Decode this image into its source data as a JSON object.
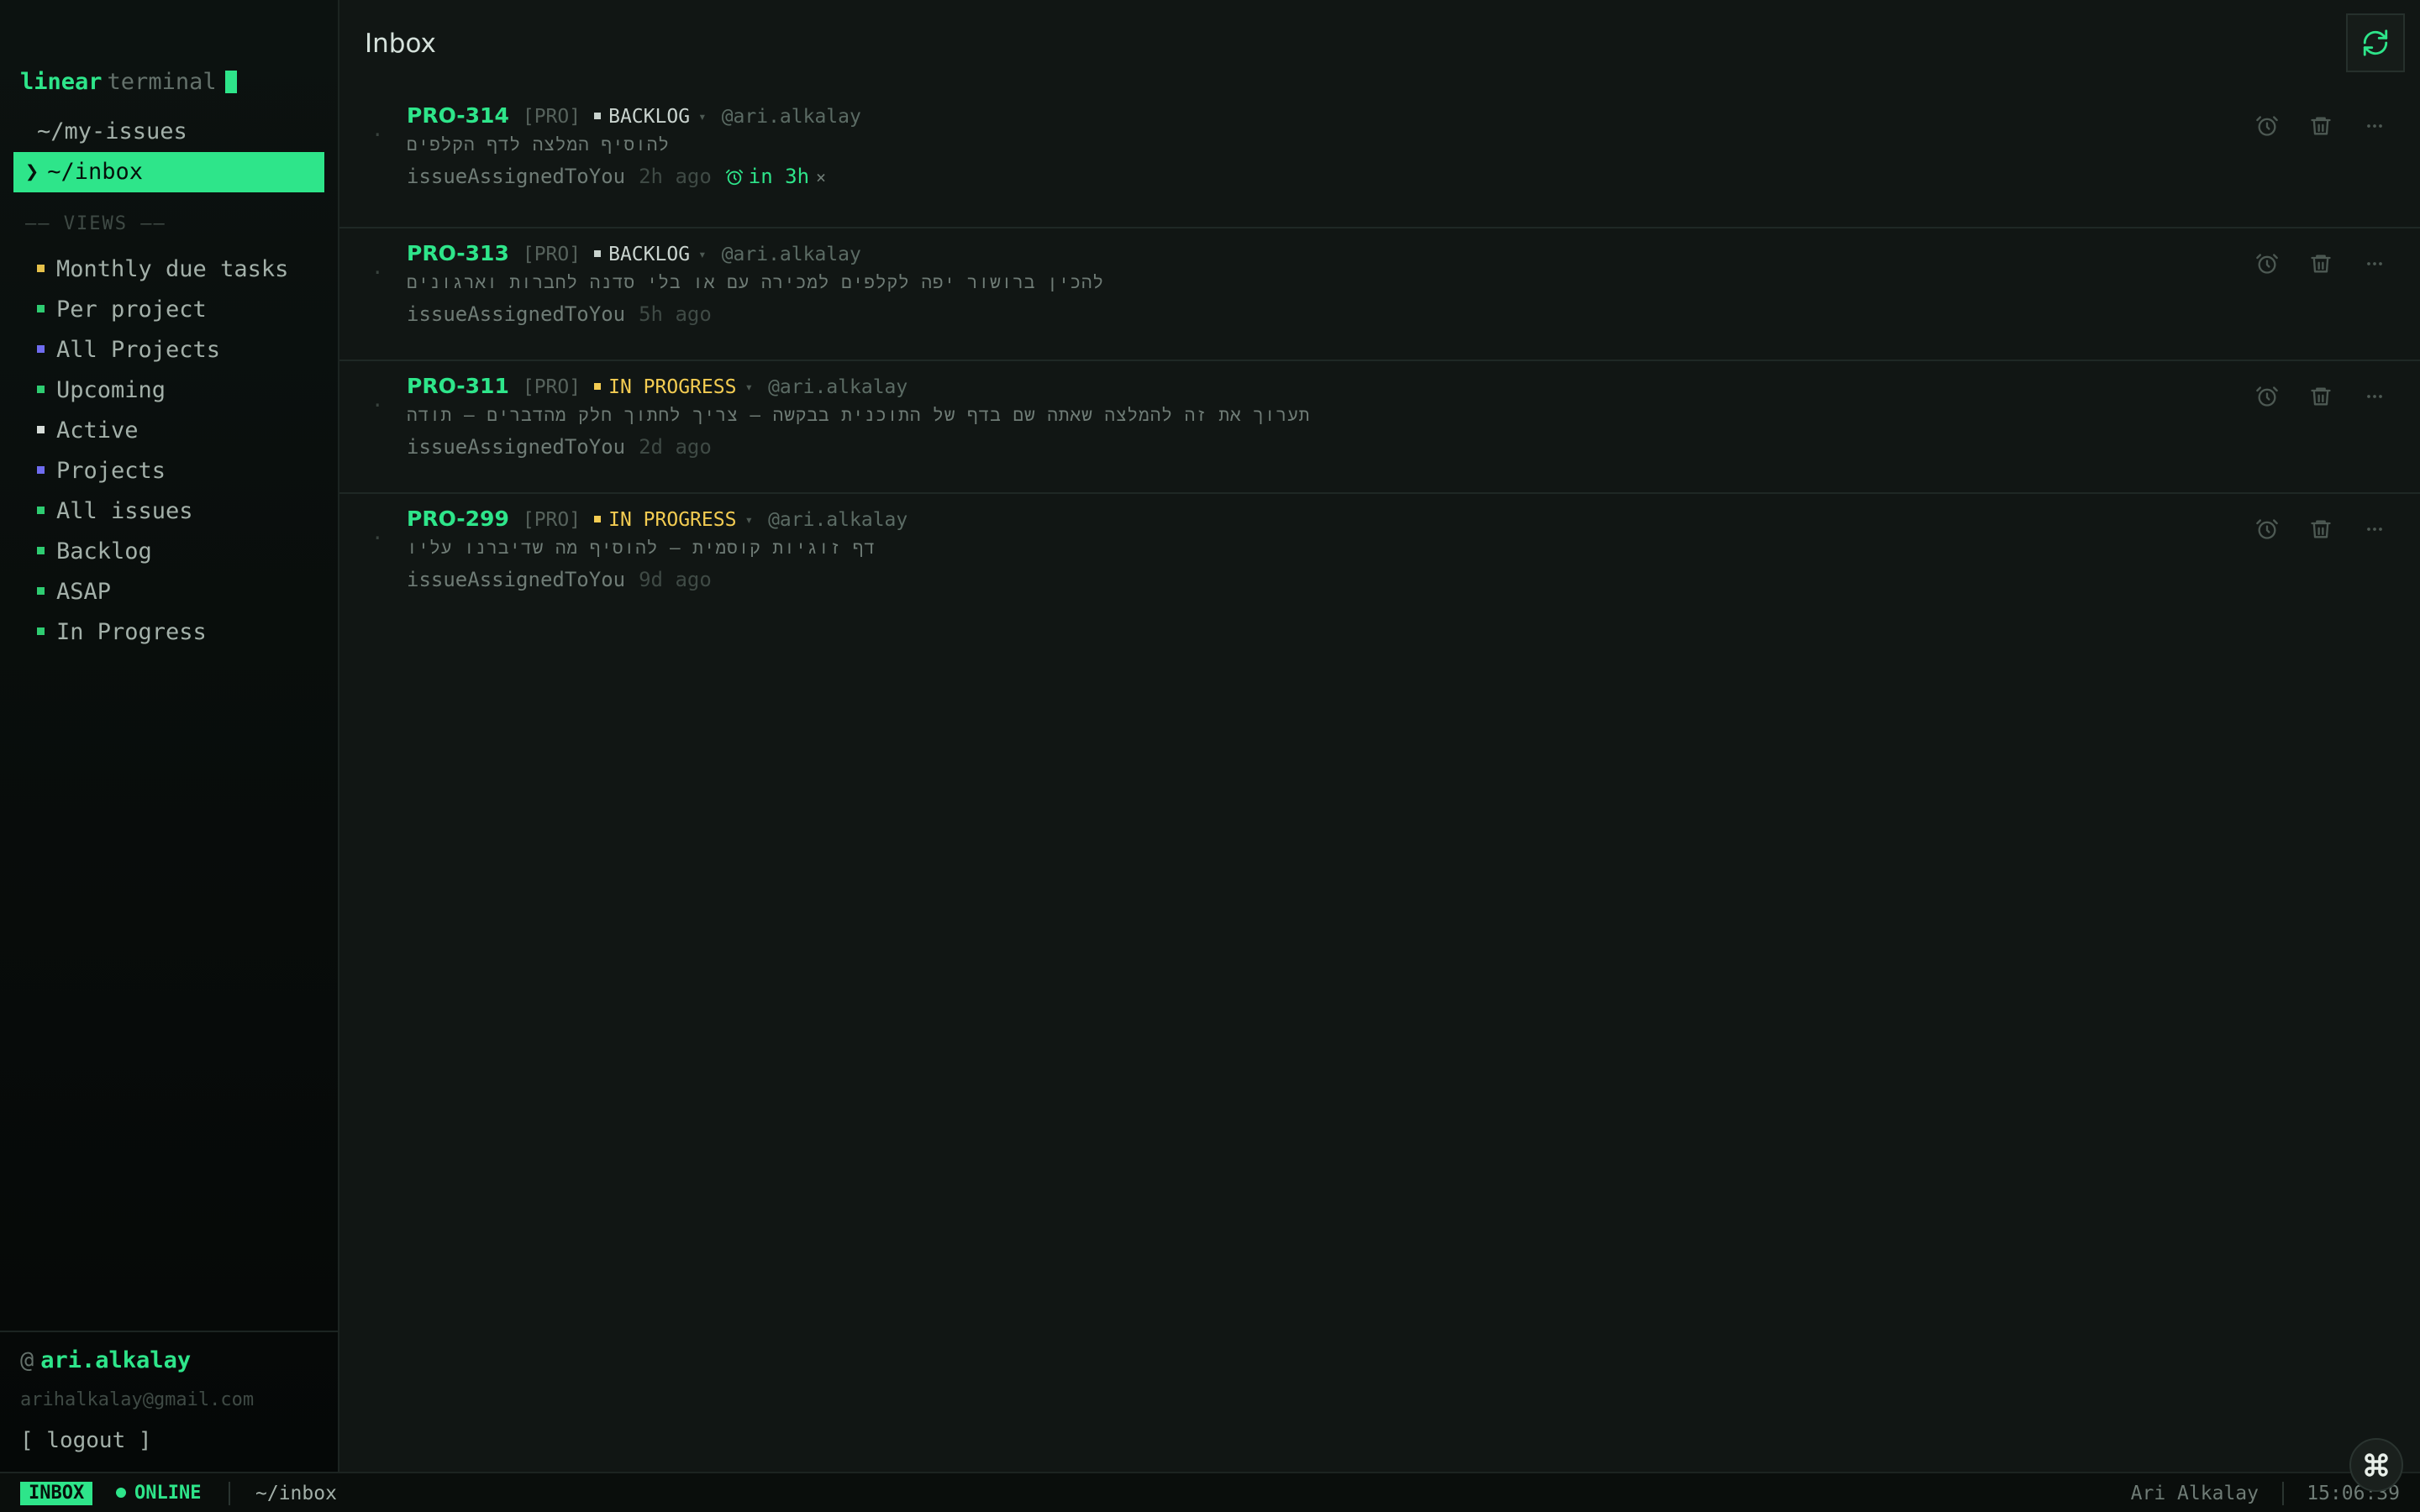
{
  "brand": {
    "name": "linear",
    "suffix": "terminal"
  },
  "nav": {
    "my_issues": "~/my-issues",
    "inbox_chevron": "❯",
    "inbox": "~/inbox"
  },
  "views": {
    "title": "—— VIEWS ——",
    "items": [
      {
        "label": "Monthly due tasks",
        "color": "#e6c14a"
      },
      {
        "label": "Per project",
        "color": "#2ecc71"
      },
      {
        "label": "All Projects",
        "color": "#6f6cf0"
      },
      {
        "label": "Upcoming",
        "color": "#2ecc71"
      },
      {
        "label": "Active",
        "color": "#d7ddd9"
      },
      {
        "label": "Projects",
        "color": "#6f6cf0"
      },
      {
        "label": "All issues",
        "color": "#2ecc71"
      },
      {
        "label": "Backlog",
        "color": "#2ecc71"
      },
      {
        "label": "ASAP",
        "color": "#2ecc71"
      },
      {
        "label": "In Progress",
        "color": "#2ecc71"
      }
    ]
  },
  "user": {
    "at": "@",
    "name": "ari.alkalay",
    "email": "arihalkalay@gmail.com",
    "logout": "[ logout ]"
  },
  "main": {
    "title": "Inbox",
    "rows": [
      {
        "dot": ".",
        "id": "PRO-314",
        "team": "[PRO]",
        "status": "BACKLOG",
        "status_kind": "backlog",
        "caret": "▾",
        "assignee": "@ari.alkalay",
        "desc": "להוסיף המלצה לדף הקלפים",
        "reason": "issueAssignedToYou",
        "ago": "2h ago",
        "snooze": "in 3h",
        "snooze_x": "×"
      },
      {
        "dot": ".",
        "id": "PRO-313",
        "team": "[PRO]",
        "status": "BACKLOG",
        "status_kind": "backlog",
        "caret": "▾",
        "assignee": "@ari.alkalay",
        "desc": "להכין ברושור יפה לקלפים למכירה עם או בלי סדנה לחברות וארגונים",
        "reason": "issueAssignedToYou",
        "ago": "5h ago"
      },
      {
        "dot": ".",
        "id": "PRO-311",
        "team": "[PRO]",
        "status": "IN PROGRESS",
        "status_kind": "inprog",
        "caret": "▾",
        "assignee": "@ari.alkalay",
        "desc": "תערוך את זה להמלצה שאתה שם בדף של התוכנית בבקשה — צריך לחתוך חלק מהדברים — תודה",
        "reason": "issueAssignedToYou",
        "ago": "2d ago"
      },
      {
        "dot": ".",
        "id": "PRO-299",
        "team": "[PRO]",
        "status": "IN PROGRESS",
        "status_kind": "inprog",
        "caret": "▾",
        "assignee": "@ari.alkalay",
        "desc": "דף זוגיות קוסמית — להוסיף מה שדיברנו עליו",
        "reason": "issueAssignedToYou",
        "ago": "9d ago"
      }
    ]
  },
  "statusbar": {
    "mode": "INBOX",
    "online": "ONLINE",
    "path": "~/inbox",
    "user": "Ari Alkalay",
    "clock": "15:06:39"
  },
  "icons": {
    "refresh": "refresh-icon",
    "snooze": "alarm-clock-icon",
    "delete": "trash-icon",
    "more": "more-horizontal-icon",
    "fab": "command-icon"
  },
  "colors": {
    "accent": "#2ee58a",
    "in_progress": "#f3cc52",
    "backlog": "#c9d3ce"
  }
}
